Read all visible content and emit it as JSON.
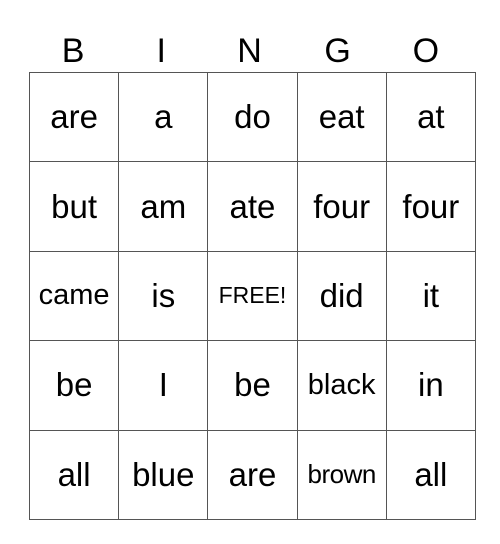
{
  "card": {
    "header": [
      "B",
      "I",
      "N",
      "G",
      "O"
    ],
    "rows": [
      [
        "are",
        "a",
        "do",
        "eat",
        "at"
      ],
      [
        "but",
        "am",
        "ate",
        "four",
        "four"
      ],
      [
        "came",
        "is",
        "FREE!",
        "did",
        "it"
      ],
      [
        "be",
        "I",
        "be",
        "black",
        "in"
      ],
      [
        "all",
        "blue",
        "are",
        "brown",
        "all"
      ]
    ],
    "free_space_label": "FREE!",
    "border_color": "#555555"
  }
}
